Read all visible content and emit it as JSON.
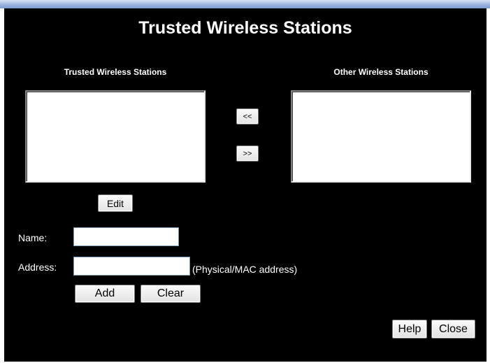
{
  "page": {
    "title": "Trusted Wireless Stations"
  },
  "lists": {
    "trusted_title": "Trusted Wireless Stations",
    "other_title": "Other Wireless Stations"
  },
  "buttons": {
    "move_left": "<<",
    "move_right": ">>",
    "edit": "Edit",
    "add": "Add",
    "clear": "Clear",
    "help": "Help",
    "close": "Close"
  },
  "form": {
    "name_label": "Name:",
    "name_value": "",
    "address_label": "Address:",
    "address_value": "",
    "address_hint": "(Physical/MAC address)"
  }
}
